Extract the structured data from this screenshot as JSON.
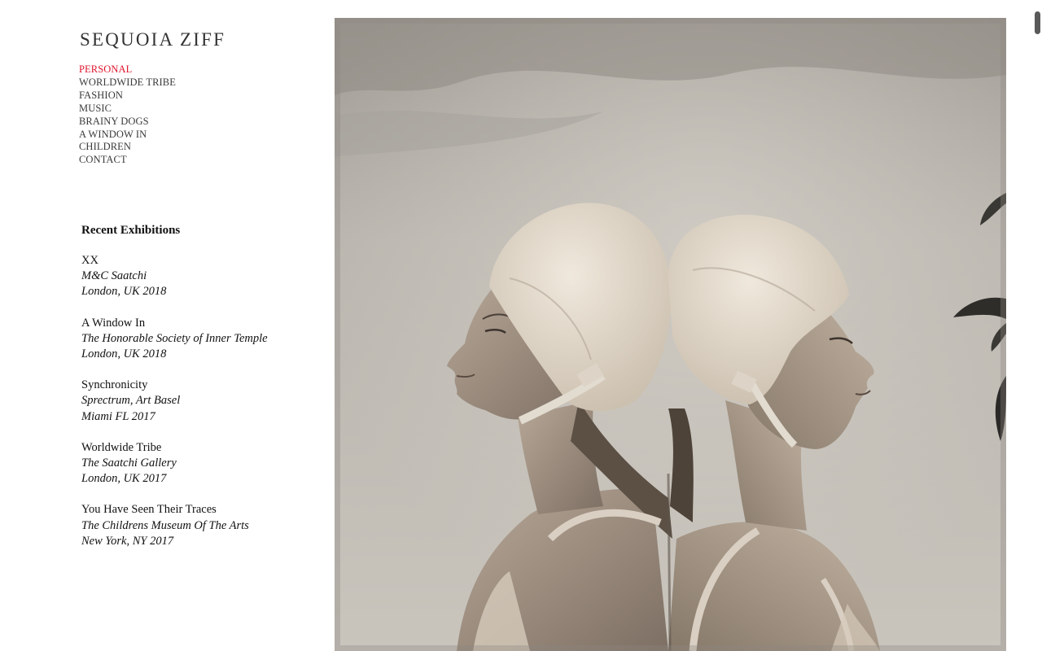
{
  "site": {
    "title": "SEQUOIA ZIFF"
  },
  "nav": {
    "items": [
      {
        "label": "PERSONAL",
        "active": true
      },
      {
        "label": "WORLDWIDE TRIBE",
        "active": false
      },
      {
        "label": "FASHION",
        "active": false
      },
      {
        "label": "MUSIC",
        "active": false
      },
      {
        "label": "BRAINY DOGS",
        "active": false
      },
      {
        "label": "A WINDOW IN",
        "active": false
      },
      {
        "label": "CHILDREN",
        "active": false
      },
      {
        "label": "CONTACT",
        "active": false
      }
    ],
    "active_color": "#e0142c"
  },
  "exhibitions": {
    "heading": "Recent Exhibitions",
    "items": [
      {
        "title": "XX",
        "venue": "M&C Saatchi",
        "location": "London, UK 2018"
      },
      {
        "title": "A Window In",
        "venue": "The Honorable Society of Inner Temple",
        "location": "London, UK 2018"
      },
      {
        "title": "Synchronicity",
        "venue": "Sprectrum, Art Basel",
        "location": "Miami FL 2017"
      },
      {
        "title": "Worldwide Tribe",
        "venue": "The Saatchi Gallery",
        "location": "London, UK 2017"
      },
      {
        "title": "You Have Seen Their Traces",
        "venue": "The Childrens Museum Of The Arts",
        "location": "New York, NY 2017"
      }
    ]
  },
  "photo": {
    "subject": "two-women-swim-caps-photo"
  }
}
